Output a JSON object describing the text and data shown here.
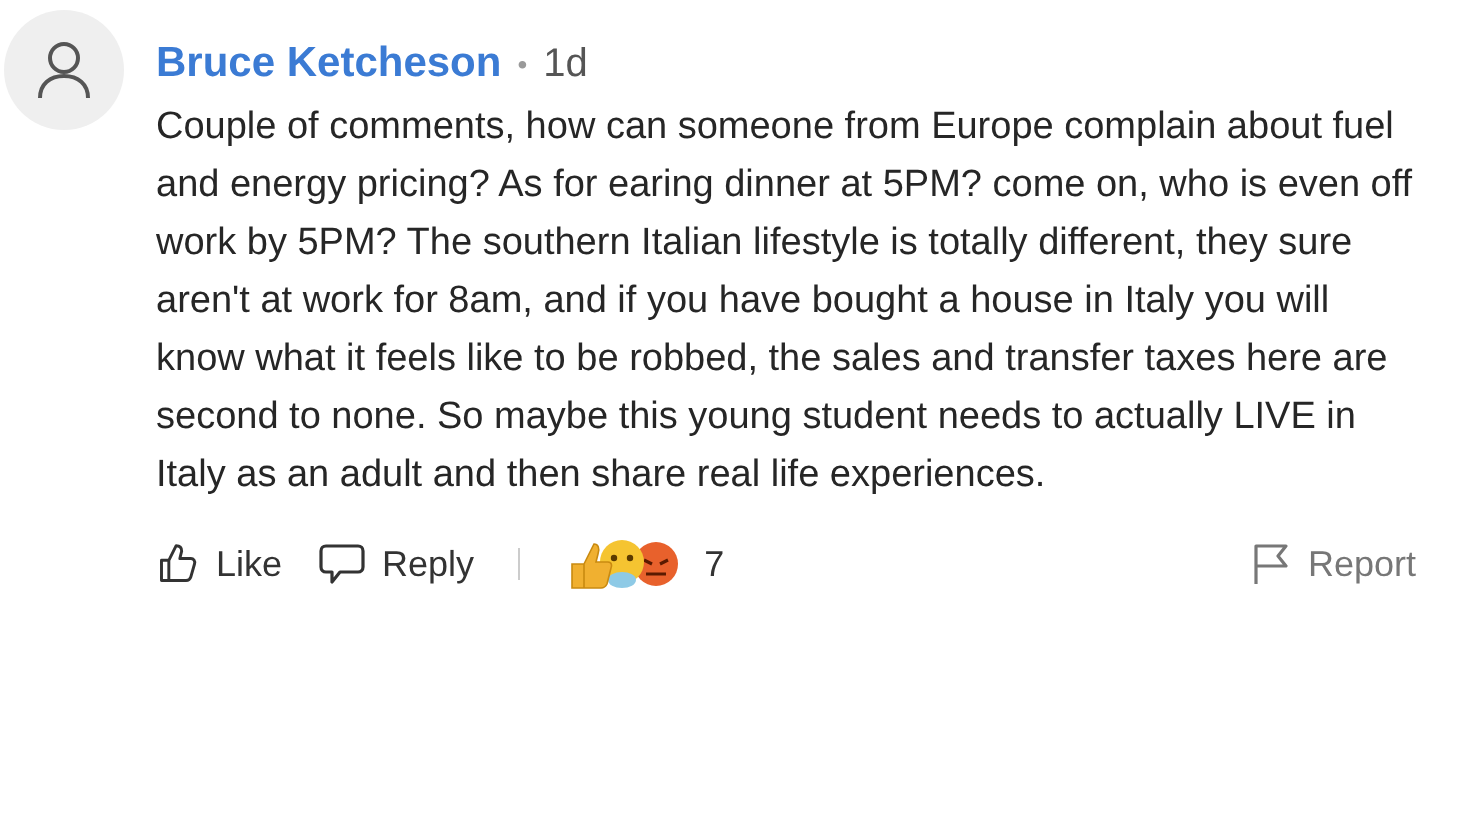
{
  "comment": {
    "author": "Bruce Ketcheson",
    "separator": "•",
    "time": "1d",
    "body": "Couple of comments, how can someone from Europe complain about fuel and energy pricing? As for earing dinner at 5PM? come on, who is even off work by 5PM? The southern Italian lifestyle is totally different, they sure aren't at work for 8am, and if you have bought a house in Italy you will know what it feels like to be robbed, the sales and transfer taxes here are second to none. So maybe this young student needs to actually LIVE in Italy as an adult and then share real life experiences."
  },
  "actions": {
    "like": "Like",
    "reply": "Reply",
    "reaction_count": "7",
    "report": "Report"
  }
}
